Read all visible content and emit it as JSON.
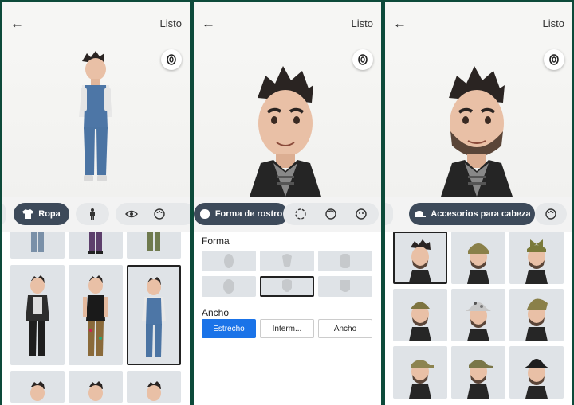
{
  "common": {
    "done_label": "Listo",
    "back_icon": "←"
  },
  "panel1": {
    "tabs": [
      {
        "label": "Ropa"
      }
    ]
  },
  "panel2": {
    "active_tab": "Forma de rostro",
    "section_shape": "Forma",
    "section_width": "Ancho",
    "width_options": [
      "Estrecho",
      "Interm...",
      "Ancho"
    ],
    "selected_width": "Estrecho"
  },
  "panel3": {
    "active_tab": "Accesorios para cabeza"
  },
  "colors": {
    "accent": "#1a73e8",
    "pill_active": "#3d4a5a",
    "cell_bg": "#dfe3e7"
  }
}
